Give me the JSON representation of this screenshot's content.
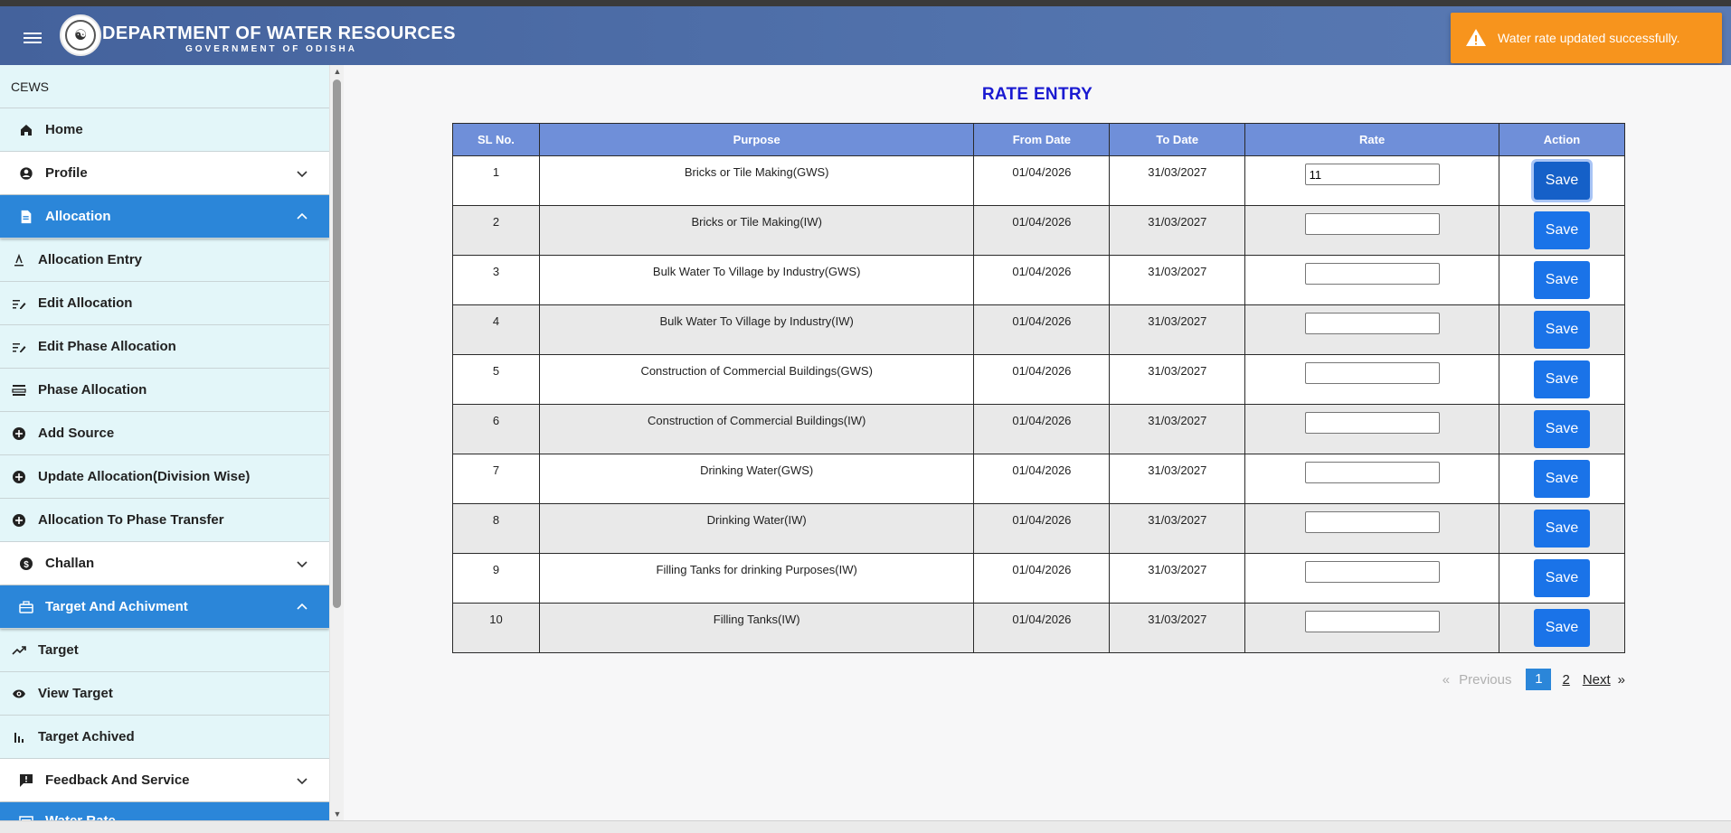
{
  "header": {
    "title": "DEPARTMENT OF WATER RESOURCES",
    "subtitle": "GOVERNMENT OF ODISHA"
  },
  "toast": {
    "message": "Water rate updated successfully.",
    "color": "#f7941d"
  },
  "sidebar": {
    "section_label": "CEWS",
    "items": [
      {
        "label": "Home",
        "icon": "home-icon"
      },
      {
        "label": "Profile",
        "icon": "user-circle-icon"
      },
      {
        "label": "Allocation",
        "icon": "document-icon"
      },
      {
        "label": "Allocation Entry",
        "icon": "text-format-icon"
      },
      {
        "label": "Edit Allocation",
        "icon": "edit-list-icon"
      },
      {
        "label": "Edit Phase Allocation",
        "icon": "edit-list-icon"
      },
      {
        "label": "Phase Allocation",
        "icon": "layers-icon"
      },
      {
        "label": "Add Source",
        "icon": "plus-circle-icon"
      },
      {
        "label": "Update Allocation(Division Wise)",
        "icon": "plus-circle-icon"
      },
      {
        "label": "Allocation To Phase Transfer",
        "icon": "plus-circle-icon"
      },
      {
        "label": "Challan",
        "icon": "dollar-circle-icon"
      },
      {
        "label": "Target And Achivment",
        "icon": "briefcase-icon"
      },
      {
        "label": "Target",
        "icon": "trending-up-icon"
      },
      {
        "label": "View Target",
        "icon": "eye-icon"
      },
      {
        "label": "Target Achived",
        "icon": "bar-chart-icon"
      },
      {
        "label": "Feedback And Service",
        "icon": "feedback-icon"
      },
      {
        "label": "Water Rate",
        "icon": "water-rate-icon"
      }
    ]
  },
  "main": {
    "title": "RATE ENTRY",
    "columns": [
      "SL No.",
      "Purpose",
      "From Date",
      "To Date",
      "Rate",
      "Action"
    ],
    "save_label": "Save",
    "rows": [
      {
        "sl": "1",
        "purpose": "Bricks or Tile Making(GWS)",
        "from": "01/04/2026",
        "to": "31/03/2027",
        "rate": "11"
      },
      {
        "sl": "2",
        "purpose": "Bricks or Tile Making(IW)",
        "from": "01/04/2026",
        "to": "31/03/2027",
        "rate": ""
      },
      {
        "sl": "3",
        "purpose": "Bulk Water To Village by Industry(GWS)",
        "from": "01/04/2026",
        "to": "31/03/2027",
        "rate": ""
      },
      {
        "sl": "4",
        "purpose": "Bulk Water To Village by Industry(IW)",
        "from": "01/04/2026",
        "to": "31/03/2027",
        "rate": ""
      },
      {
        "sl": "5",
        "purpose": "Construction of Commercial Buildings(GWS)",
        "from": "01/04/2026",
        "to": "31/03/2027",
        "rate": ""
      },
      {
        "sl": "6",
        "purpose": "Construction of Commercial Buildings(IW)",
        "from": "01/04/2026",
        "to": "31/03/2027",
        "rate": ""
      },
      {
        "sl": "7",
        "purpose": "Drinking Water(GWS)",
        "from": "01/04/2026",
        "to": "31/03/2027",
        "rate": ""
      },
      {
        "sl": "8",
        "purpose": "Drinking Water(IW)",
        "from": "01/04/2026",
        "to": "31/03/2027",
        "rate": ""
      },
      {
        "sl": "9",
        "purpose": "Filling Tanks for drinking Purposes(IW)",
        "from": "01/04/2026",
        "to": "31/03/2027",
        "rate": ""
      },
      {
        "sl": "10",
        "purpose": "Filling Tanks(IW)",
        "from": "01/04/2026",
        "to": "31/03/2027",
        "rate": ""
      }
    ]
  },
  "pagination": {
    "prev_symbol": "«",
    "previous": "Previous",
    "pages": [
      "1",
      "2"
    ],
    "current": "1",
    "next": "Next",
    "next_symbol": "»"
  }
}
